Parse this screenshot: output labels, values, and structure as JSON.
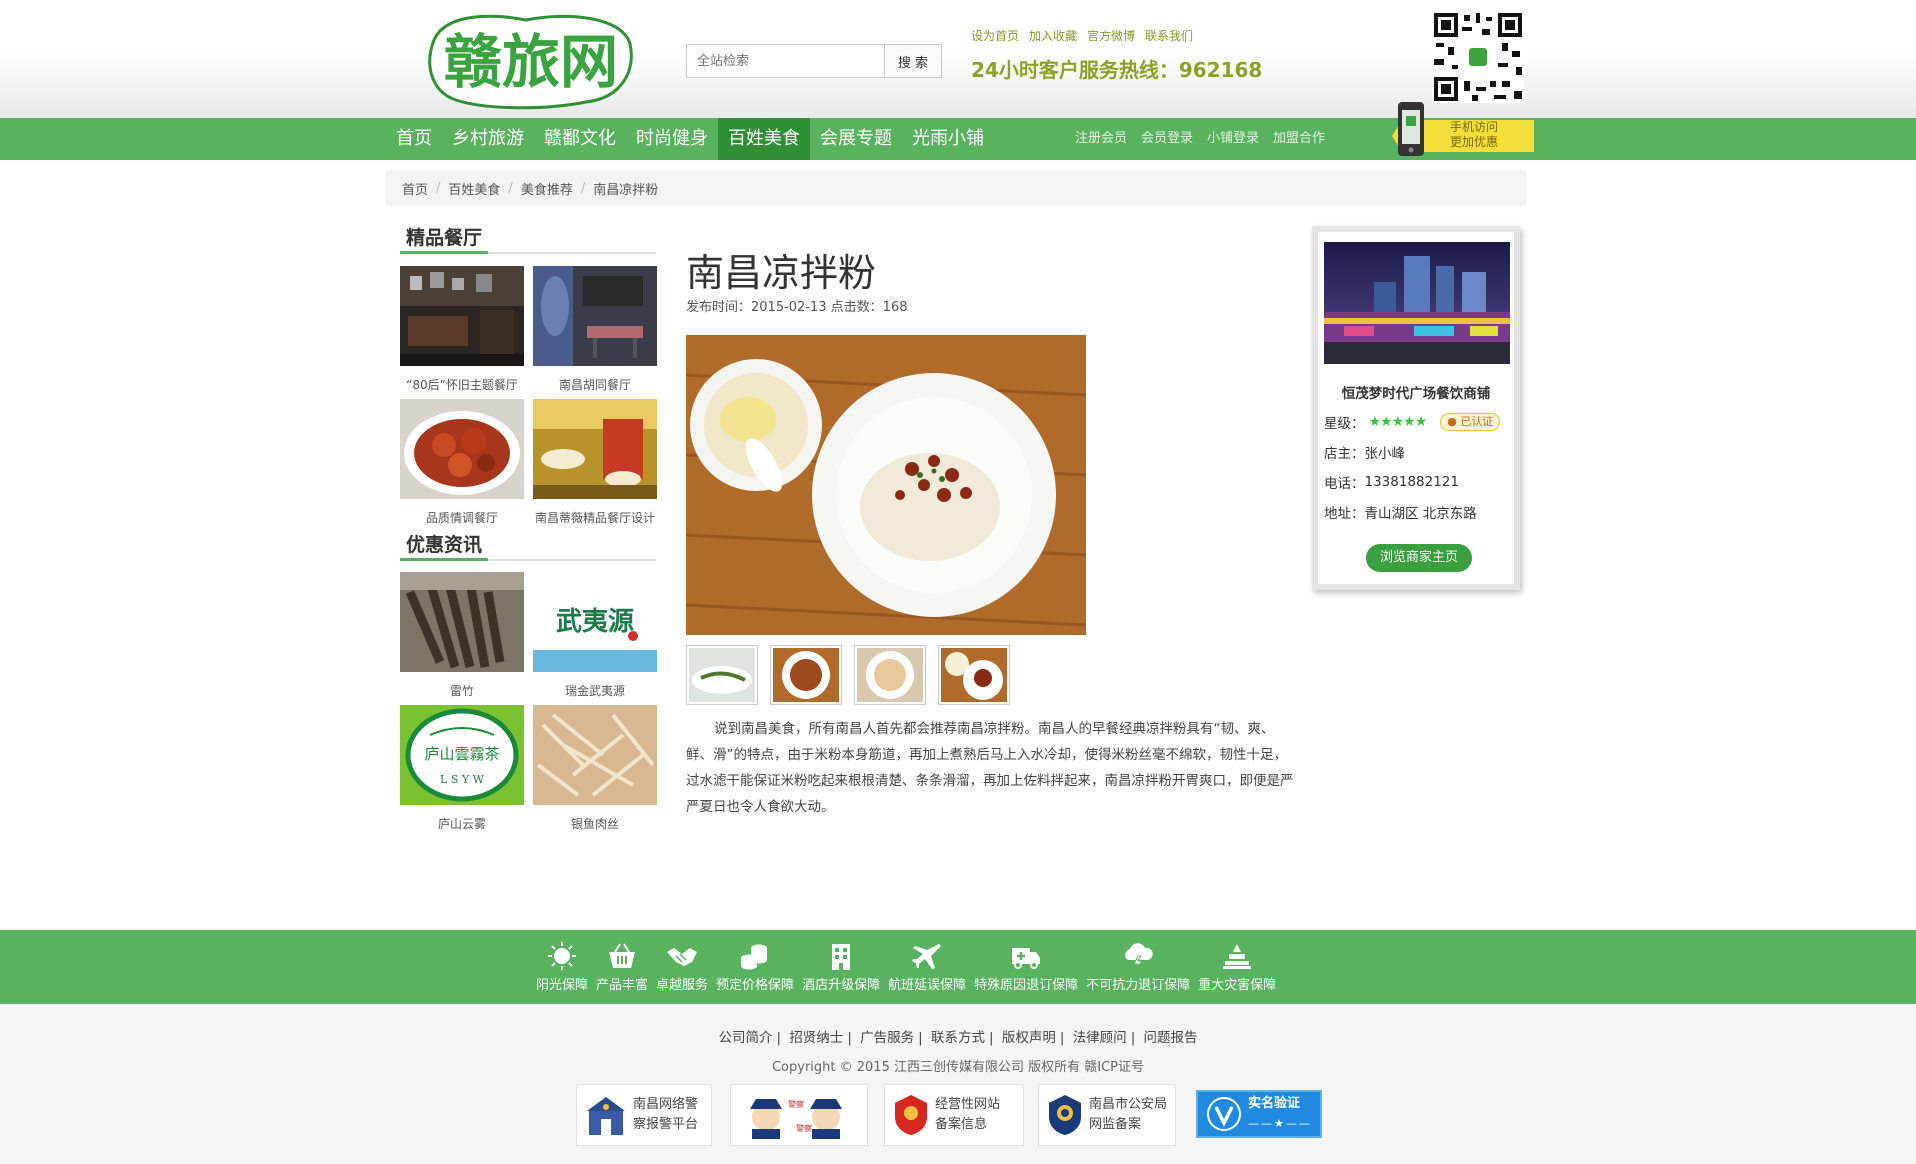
{
  "header": {
    "logo_text": "赣旅网",
    "search_placeholder": "全站检索",
    "search_button": "搜 索",
    "top_links": [
      "设为首页",
      "加入收藏",
      "官方微博",
      "联系我们"
    ],
    "hotline": "24小时客户服务热线：962168",
    "qr_icon": "qr-code-icon"
  },
  "nav": {
    "items": [
      "首页",
      "乡村旅游",
      "赣鄱文化",
      "时尚健身",
      "百姓美食",
      "会展专题",
      "光雨小铺"
    ],
    "active_index": 4,
    "sub_links": [
      "注册会员",
      "会员登录",
      "小铺登录",
      "加盟合作"
    ],
    "mobile_promo": [
      "手机访问",
      "更加优惠"
    ]
  },
  "breadcrumb": [
    "首页",
    "百姓美食",
    "美食推荐",
    "南昌凉拌粉"
  ],
  "sidebar": {
    "restaurants_title": "精品餐厅",
    "restaurants": [
      "“80后”怀旧主题餐厅",
      "南昌胡同餐厅",
      "品质情调餐厅",
      "南昌蒂薇精品餐厅设计"
    ],
    "deals_title": "优惠资讯",
    "deals": [
      "雷竹",
      "瑞金武夷源",
      "庐山云雾",
      "银鱼肉丝"
    ],
    "logo_lettering": [
      "武夷源",
      "庐山雲霧茶",
      "L S Y W"
    ]
  },
  "article": {
    "title": "南昌凉拌粉",
    "meta": "发布时间：2015-02-13 点击数：168",
    "body": "说到南昌美食，所有南昌人首先都会推荐南昌凉拌粉。南昌人的早餐经典凉拌粉具有“韧、爽、鲜、滑”的特点，由于米粉本身筋道，再加上煮熟后马上入水冷却，使得米粉丝毫不绵软，韧性十足，过水滤干能保证米粉吃起来根根清楚、条条滑溜，再加上佐料拌起来，南昌凉拌粉开胃爽口，即便是严严夏日也令人食欲大动。"
  },
  "shop": {
    "name": "恒茂梦时代广场餐饮商铺",
    "rating_label": "星级：",
    "rating": 5,
    "certified": "已认证",
    "owner_label": "店主：",
    "owner": "张小峰",
    "phone_label": "电话：",
    "phone": "13381882121",
    "address_label": "地址：",
    "address": "青山湖区 北京东路",
    "visit_button": "浏览商家主页"
  },
  "guarantees": [
    {
      "label": "阳光保障",
      "icon": "sun-icon"
    },
    {
      "label": "产品丰富",
      "icon": "basket-icon"
    },
    {
      "label": "卓越服务",
      "icon": "handshake-icon"
    },
    {
      "label": "预定价格保障",
      "icon": "coins-icon"
    },
    {
      "label": "酒店升级保障",
      "icon": "building-icon"
    },
    {
      "label": "航班延误保障",
      "icon": "airplane-icon"
    },
    {
      "label": "特殊原因退订保障",
      "icon": "ambulance-icon"
    },
    {
      "label": "不可抗力退订保障",
      "icon": "storm-icon"
    },
    {
      "label": "重大灾害保障",
      "icon": "disaster-icon"
    }
  ],
  "footer": {
    "links": [
      "公司简介",
      "招贤纳士",
      "广告服务",
      "联系方式",
      "版权声明",
      "法律顾问",
      "问题报告"
    ],
    "copyright": "Copyright © 2015 江西三创传媒有限公司 版权所有 赣ICP证号",
    "badges": [
      [
        "南昌网络警",
        "察报警平台"
      ],
      [
        "经营性网站",
        "备案信息"
      ],
      [
        "南昌市公安局",
        "网监备案"
      ],
      [
        "实名验证"
      ]
    ],
    "police_badge_text": [
      "警察",
      "警察"
    ]
  },
  "colors": {
    "nav_green": "#59b35e",
    "active_green": "#2f8f33",
    "hotline": "#8aa324"
  }
}
